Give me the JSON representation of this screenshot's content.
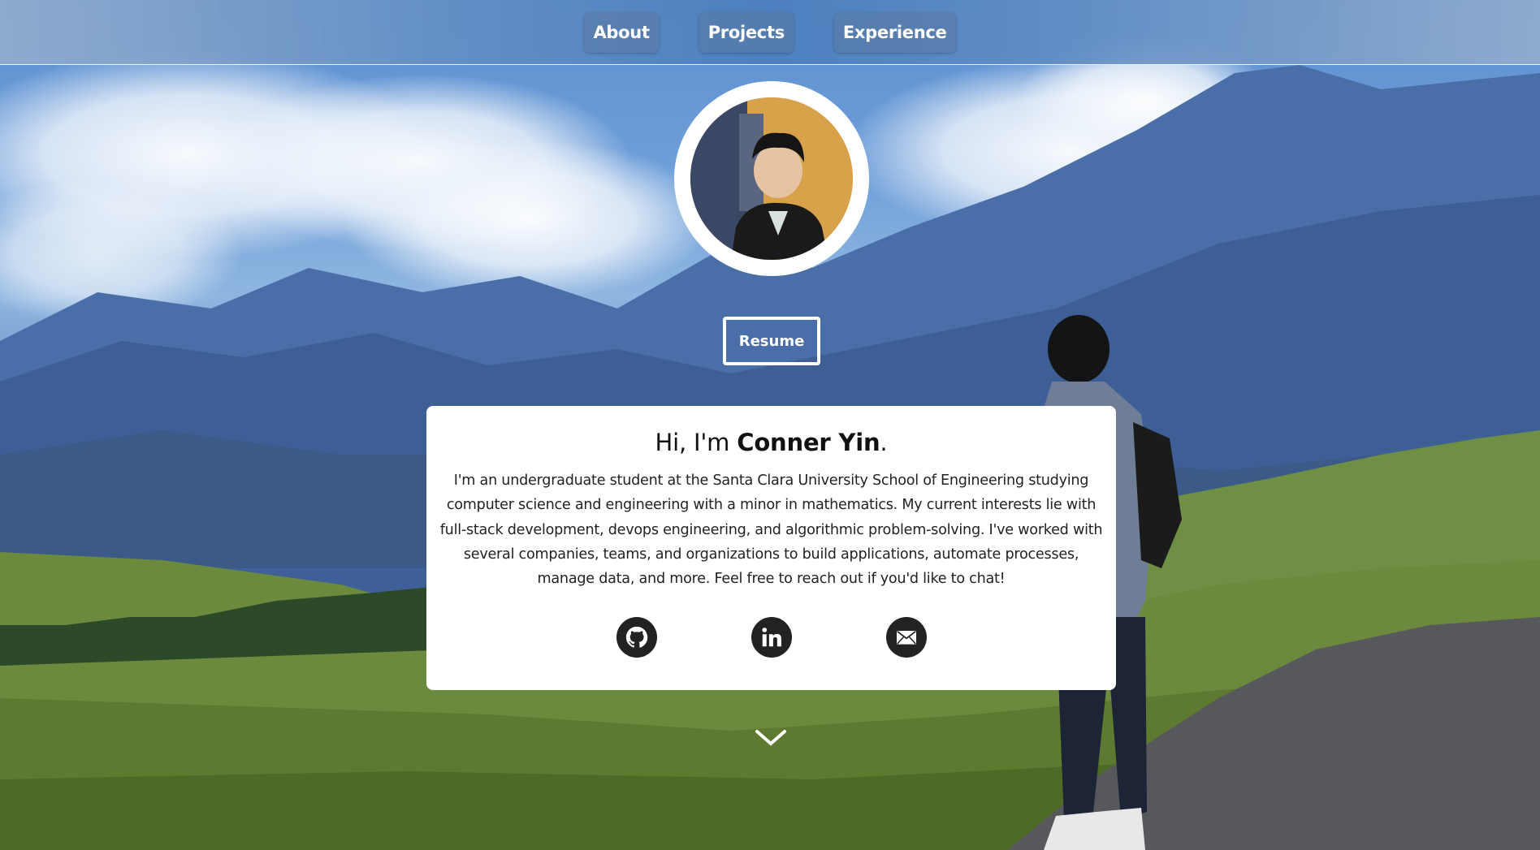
{
  "nav": {
    "items": [
      {
        "label": "About"
      },
      {
        "label": "Projects"
      },
      {
        "label": "Experience"
      }
    ]
  },
  "hero": {
    "resume_label": "Resume",
    "greeting_prefix": "Hi, I'm ",
    "name": "Conner Yin",
    "greeting_suffix": ".",
    "bio": "I'm an undergraduate student at the Santa Clara University School of Engineering studying computer science and engineering with a minor in mathematics. My current interests lie with full-stack development, devops engineering, and algorithmic problem-solving. I've worked with several companies, teams, and organizations to build applications, automate processes, manage data, and more. Feel free to reach out if you'd like to chat!"
  },
  "socials": [
    {
      "icon": "github-icon"
    },
    {
      "icon": "linkedin-icon"
    },
    {
      "icon": "email-icon"
    }
  ],
  "colors": {
    "card_bg": "#ffffff",
    "icon_bg": "#222222",
    "nav_text": "#ffffff",
    "sky": "#5b8fd0"
  }
}
